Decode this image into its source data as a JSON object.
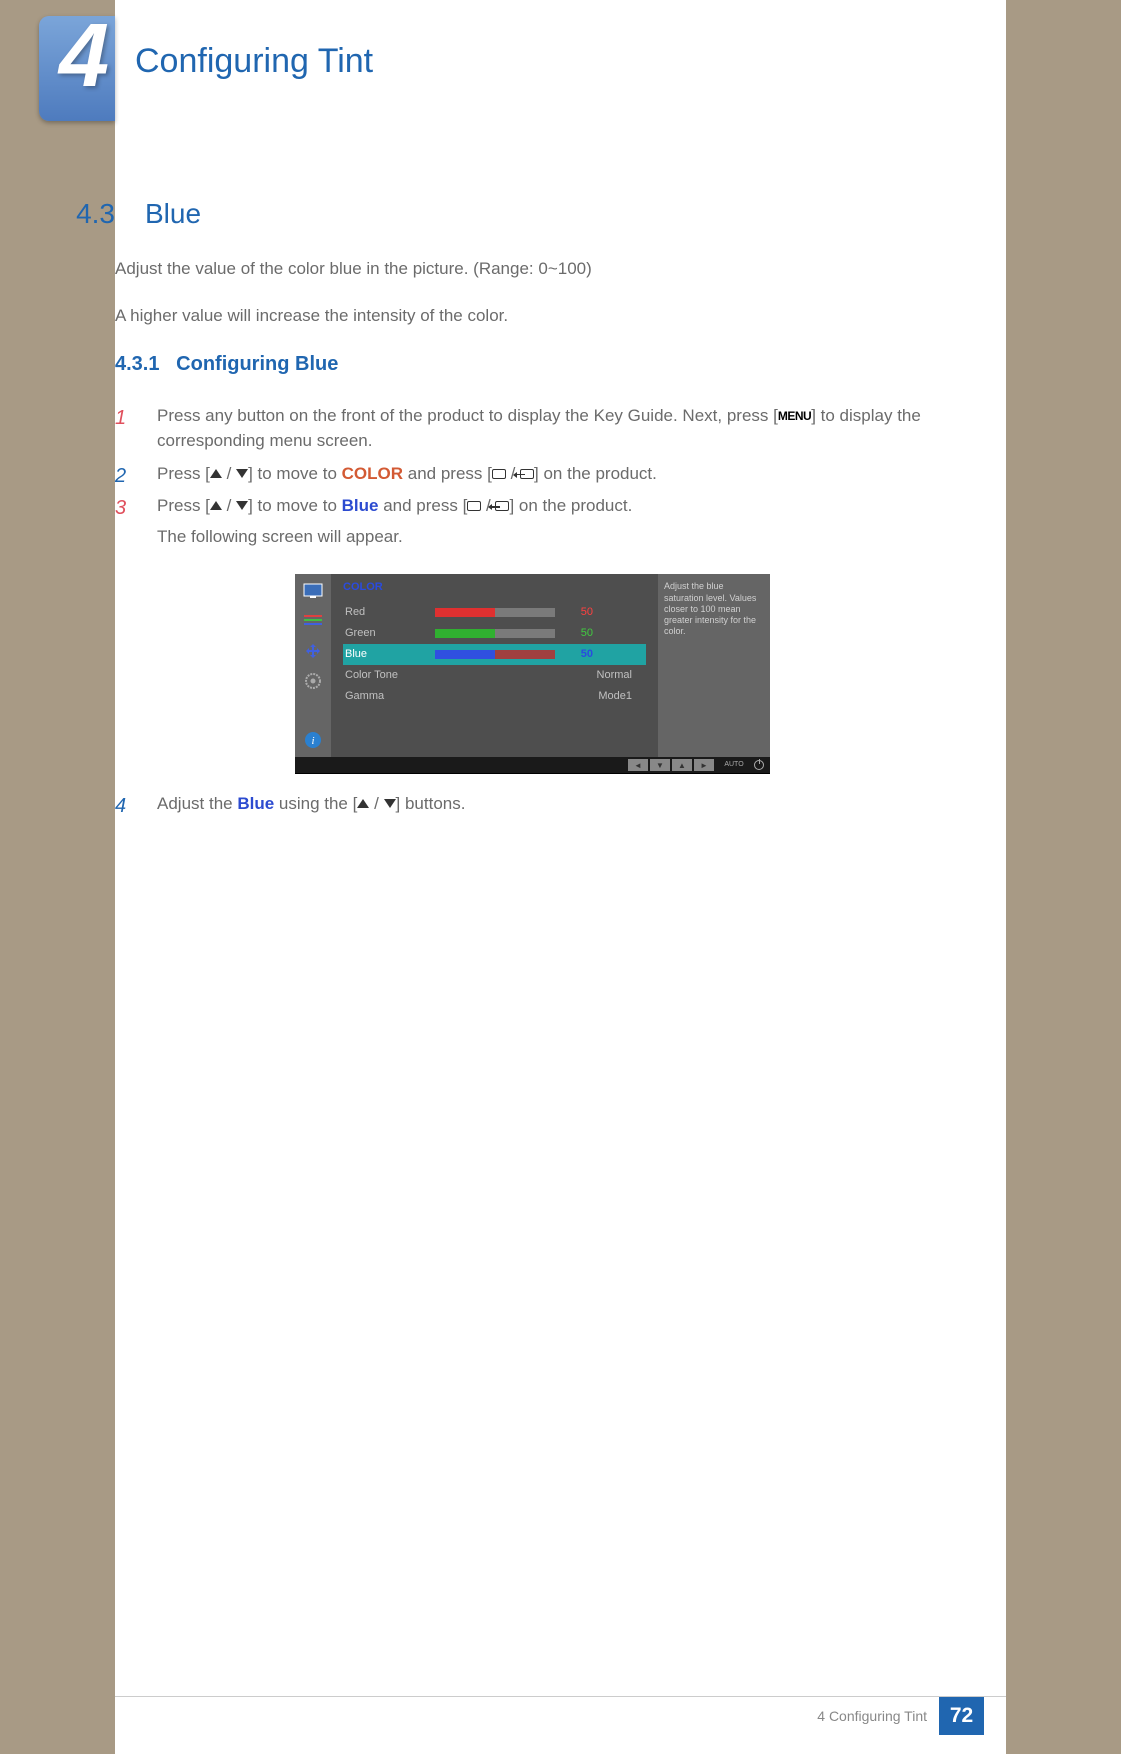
{
  "chapter": {
    "num": "4",
    "title": "Configuring Tint"
  },
  "section": {
    "num": "4.3",
    "title": "Blue"
  },
  "intro": {
    "p1": "Adjust the value of the color blue in the picture. (Range: 0~100)",
    "p2": "A higher value will increase the intensity of the color."
  },
  "subsection": {
    "num": "4.3.1",
    "title": "Configuring Blue"
  },
  "steps": {
    "s1a": "Press any button on the front of the product to display the Key Guide. Next, press [",
    "s1_menu": "MENU",
    "s1b": "] to display the corresponding menu screen.",
    "s2a": "Press [",
    "s2b": "] to move to ",
    "s2_color": "COLOR",
    "s2c": " and press [",
    "s2d": "] on the product.",
    "s3a": "Press [",
    "s3b": "] to move to ",
    "s3_blue": "Blue",
    "s3c": " and press [",
    "s3d": "] on the product.",
    "s3e": "The following screen will appear.",
    "s4a": "Adjust the ",
    "s4_blue": "Blue",
    "s4b": " using the [",
    "s4c": "] buttons."
  },
  "osd": {
    "header": "COLOR",
    "rows": {
      "red": {
        "label": "Red",
        "value": "50"
      },
      "green": {
        "label": "Green",
        "value": "50"
      },
      "blue": {
        "label": "Blue",
        "value": "50"
      },
      "colortone": {
        "label": "Color Tone",
        "value": "Normal"
      },
      "gamma": {
        "label": "Gamma",
        "value": "Mode1"
      }
    },
    "tip": "Adjust the blue saturation level. Values closer to 100 mean greater intensity for the color.",
    "nav_auto": "AUTO"
  },
  "footer": {
    "label": "4 Configuring Tint",
    "page": "72"
  }
}
